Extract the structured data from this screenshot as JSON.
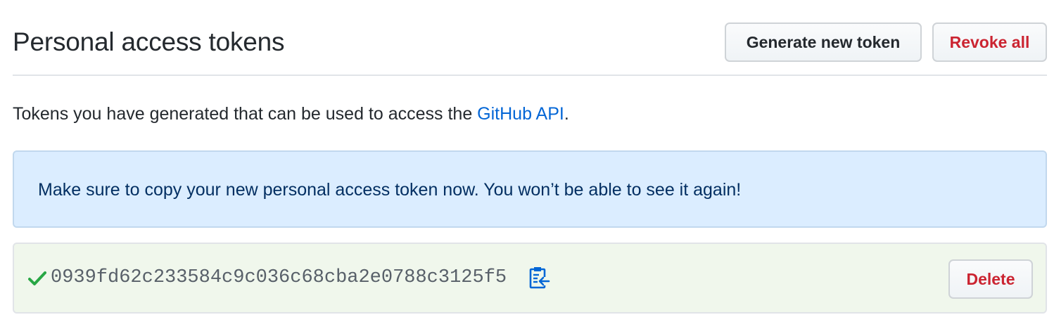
{
  "header": {
    "title": "Personal access tokens",
    "generate_button_label": "Generate new token",
    "revoke_all_button_label": "Revoke all"
  },
  "description": {
    "text_before_link": "Tokens you have generated that can be used to access the ",
    "link_text": "GitHub API",
    "text_after_link": "."
  },
  "flash": {
    "message": "Make sure to copy your new personal access token now. You won’t be able to see it again!"
  },
  "token": {
    "value": "0939fd62c233584c9c036c68cba2e0788c3125f5",
    "status_icon": "check-icon",
    "copy_icon": "clipboard-icon",
    "delete_button_label": "Delete"
  },
  "colors": {
    "link": "#0366d6",
    "danger": "#cb2431",
    "success": "#28a745",
    "info_background": "#dbedff",
    "success_background": "#f0f7ec"
  }
}
